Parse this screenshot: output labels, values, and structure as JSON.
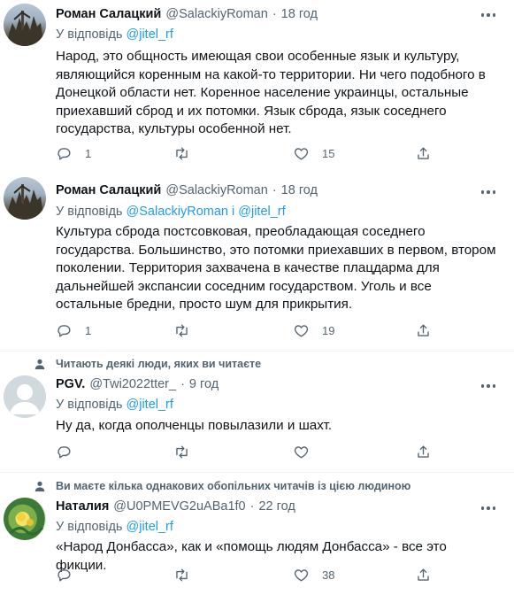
{
  "tweets": [
    {
      "name": "Роман Салацкий",
      "handle": "@SalackiyRoman",
      "time": "18 год",
      "reply_prefix": "У відповідь",
      "reply_mentions": "@jitel_rf",
      "text": "Народ, это общность имеющая свои особенные язык и культуру, являющийся коренным на какой-то территории. Ни чего подобного в Донецкой области нет. Коренное население украинцы, остальные приехавший сброд и их потомки. Язык сброда, язык соседнего государства, культуры особенной нет.",
      "replies": "1",
      "retweets": "",
      "likes": "15"
    },
    {
      "name": "Роман Салацкий",
      "handle": "@SalackiyRoman",
      "time": "18 год",
      "reply_prefix": "У відповідь",
      "reply_mentions": "@SalackiyRoman і @jitel_rf",
      "text": "Культура сброда постсовковая, преобладающая соседнего государства. Большинство, это потомки приехавших в первом, втором поколении. Территория захвачена в качестве плацдарма для дальнейшей экспансии соседним государством. Уголь и все остальные бредни, просто шум для прикрытия.",
      "replies": "1",
      "retweets": "",
      "likes": "19"
    },
    {
      "social_context": "Читають деякі люди, яких ви читаєте",
      "name": "PGV.",
      "handle": "@Twi2022tter_",
      "time": "9 год",
      "reply_prefix": "У відповідь",
      "reply_mentions": "@jitel_rf",
      "text": "Ну да, когда ополченцы повылазили и шахт.",
      "replies": "",
      "retweets": "",
      "likes": ""
    },
    {
      "social_context": "Ви маєте кілька однакових обопільних читачів із цією людиною",
      "name": "Наталия",
      "handle": "@U0PMEVG2uABa1f0",
      "time": "22 год",
      "reply_prefix": "У відповідь",
      "reply_mentions": "@jitel_rf",
      "text": "«Народ Донбасса», как и «помощь людям Донбасса» - все это фикции.",
      "replies": "",
      "retweets": "",
      "likes": "38"
    }
  ],
  "icons": {
    "reply": "reply-icon",
    "retweet": "retweet-icon",
    "like": "heart-icon",
    "share": "share-icon",
    "more": "more-icon",
    "social": "person-icon"
  },
  "colors": {
    "text": "#0f1419",
    "muted": "#536471",
    "link": "#1d9bf0",
    "separator": "#eff3f4"
  }
}
